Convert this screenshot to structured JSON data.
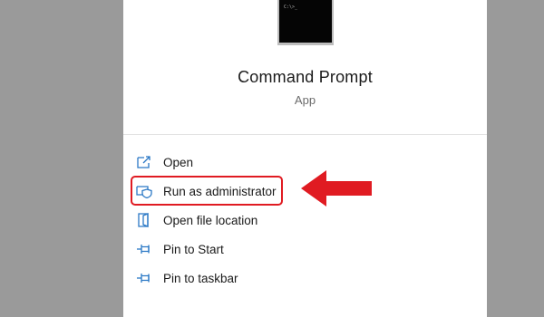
{
  "app": {
    "title": "Command Prompt",
    "type": "App",
    "tile_text": "C:\\>_"
  },
  "menu": {
    "items": [
      {
        "id": "open",
        "label": "Open",
        "icon": "open-icon"
      },
      {
        "id": "run-as-admin",
        "label": "Run as administrator",
        "icon": "shield-icon"
      },
      {
        "id": "open-file-location",
        "label": "Open file location",
        "icon": "folder-icon"
      },
      {
        "id": "pin-to-start",
        "label": "Pin to Start",
        "icon": "pin-icon"
      },
      {
        "id": "pin-to-taskbar",
        "label": "Pin to taskbar",
        "icon": "pin-icon"
      }
    ]
  },
  "colors": {
    "accent": "#2b78c5",
    "highlight": "#e01b22",
    "background": "#9a9a9a",
    "panel": "#ffffff"
  }
}
